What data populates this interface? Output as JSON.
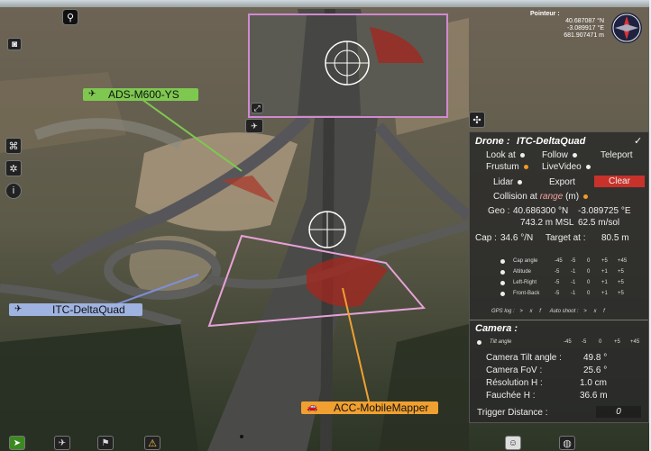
{
  "pointer": {
    "title": "Pointeur :",
    "lat": "40.687087 °N",
    "lon": "-3.089917 °E",
    "alt": "681.907471 m"
  },
  "labels": {
    "ads": "ADS-M600-YS",
    "itc": "ITC-DeltaQuad",
    "acc": "ACC-MobileMapper"
  },
  "drone_panel": {
    "title": "Drone :",
    "name": "ITC-DeltaQuad",
    "check": "✓",
    "look_at": "Look at",
    "follow": "Follow",
    "teleport": "Teleport",
    "frustum": "Frustum",
    "livevideo": "LiveVideo",
    "lidar": "Lidar",
    "export": "Export",
    "clear": "Clear",
    "collision_prefix": "Collision at",
    "collision_range": "range",
    "collision_unit": "(m)",
    "geo_label": "Geo :",
    "geo_lat": "40.686300 °N",
    "geo_lon": "-3.089725 °E",
    "msl": "743.2 m MSL",
    "speed": "62.5 m/sol",
    "cap_label": "Cap :",
    "cap_value": "34.6 °/N",
    "target_label": "Target at :",
    "target_value": "80.5 m",
    "rows": [
      {
        "name": "Cap angle",
        "vals": [
          "-45",
          "-5",
          "0",
          "+5",
          "+45"
        ]
      },
      {
        "name": "Altitude",
        "vals": [
          "-5",
          "-1",
          "0",
          "+1",
          "+5"
        ]
      },
      {
        "name": "Left-Right",
        "vals": [
          "-5",
          "-1",
          "0",
          "+1",
          "+5"
        ]
      },
      {
        "name": "Front-Back",
        "vals": [
          "-5",
          "-1",
          "0",
          "+1",
          "+5"
        ]
      }
    ],
    "gps_log": "GPS log :",
    "gps_btns": [
      ">",
      "x",
      "f"
    ],
    "auto_shoot": "Auto shoot :",
    "auto_btns": [
      ">",
      "x",
      "f"
    ]
  },
  "camera_panel": {
    "title": "Camera :",
    "tilt_label": "Tilt angle",
    "tilt_vals": [
      "-45",
      "-5",
      "0",
      "+5",
      "+45"
    ],
    "tilt_angle_label": "Camera Tilt angle :",
    "tilt_angle_value": "49.8 °",
    "fov_label": "Camera FoV :",
    "fov_value": "25.6 °",
    "res_label": "Résolution H :",
    "res_value": "1.0 cm",
    "fauchee_label": "Fauchée H :",
    "fauchee_value": "36.6 m",
    "trigger_label": "Trigger Distance :",
    "trigger_value": "0"
  },
  "colors": {
    "ads_tag": "#7ec850",
    "itc_tag": "#9fb3e0",
    "acc_tag": "#f0a030",
    "orange_dot": "#f39a24",
    "clear_btn": "#c8322a",
    "frame": "#e6a2d8"
  }
}
